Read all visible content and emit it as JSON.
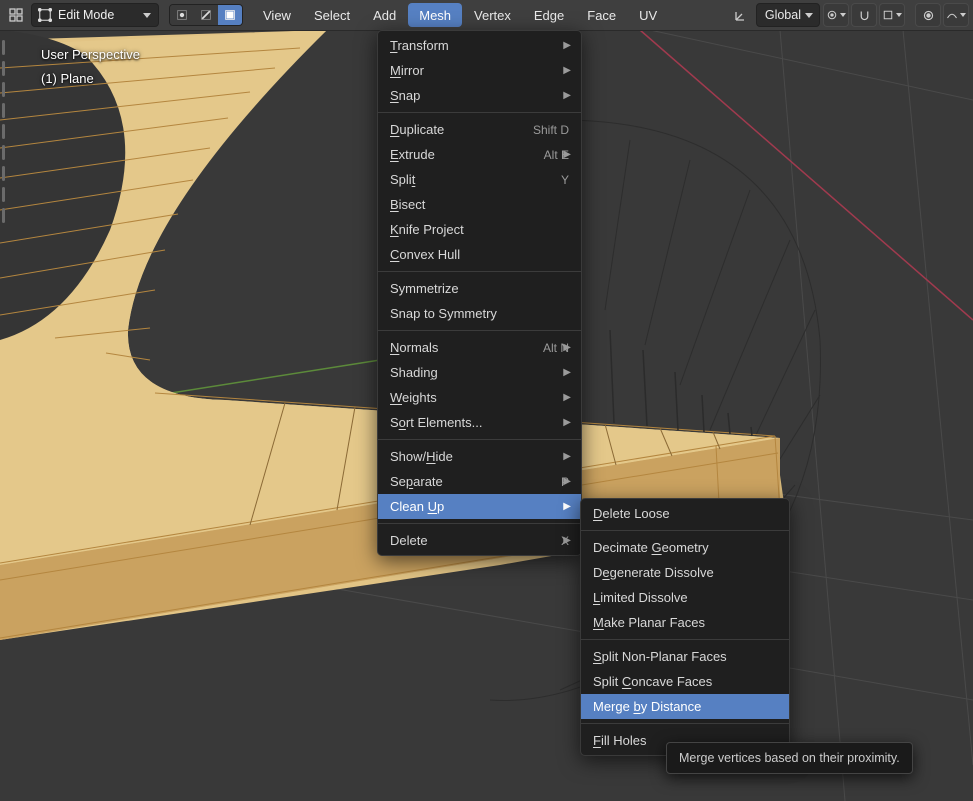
{
  "header": {
    "mode": "Edit Mode",
    "menus": [
      "View",
      "Select",
      "Add",
      "Mesh",
      "Vertex",
      "Edge",
      "Face",
      "UV"
    ],
    "active_menu": "Mesh",
    "orientation": "Global"
  },
  "overlay": {
    "perspective": "User Perspective",
    "object": "(1) Plane"
  },
  "mesh_menu": {
    "groups": [
      [
        {
          "pre": "",
          "u": "T",
          "post": "ransform",
          "sub": true
        },
        {
          "pre": "",
          "u": "M",
          "post": "irror",
          "sub": true
        },
        {
          "pre": "",
          "u": "S",
          "post": "nap",
          "sub": true
        }
      ],
      [
        {
          "pre": "",
          "u": "D",
          "post": "uplicate",
          "sc": "Shift D"
        },
        {
          "pre": "",
          "u": "E",
          "post": "xtrude",
          "sc": "Alt E",
          "sub": true
        },
        {
          "pre": "Spli",
          "u": "t",
          "post": "",
          "sc": "Y"
        },
        {
          "pre": "",
          "u": "B",
          "post": "isect"
        },
        {
          "pre": "",
          "u": "K",
          "post": "nife Project"
        },
        {
          "pre": "",
          "u": "C",
          "post": "onvex Hull"
        }
      ],
      [
        {
          "pre": "Symmetrize",
          "u": "",
          "post": ""
        },
        {
          "pre": "Snap to Symmetry",
          "u": "",
          "post": ""
        }
      ],
      [
        {
          "pre": "",
          "u": "N",
          "post": "ormals",
          "sc": "Alt N",
          "sub": true
        },
        {
          "pre": "Shadin",
          "u": "g",
          "post": "",
          "sub": true
        },
        {
          "pre": "",
          "u": "W",
          "post": "eights",
          "sub": true
        },
        {
          "pre": "S",
          "u": "o",
          "post": "rt Elements...",
          "sub": true
        }
      ],
      [
        {
          "pre": "Show/",
          "u": "H",
          "post": "ide",
          "sub": true
        },
        {
          "pre": "Se",
          "u": "p",
          "post": "arate",
          "sc": "P",
          "sub": true
        },
        {
          "pre": "Clean ",
          "u": "U",
          "post": "p",
          "sub": true,
          "hl": true
        }
      ],
      [
        {
          "pre": "Delete",
          "u": "",
          "post": "",
          "sc": "X",
          "sub": true
        }
      ]
    ]
  },
  "cleanup_menu": {
    "groups": [
      [
        {
          "pre": "",
          "u": "D",
          "post": "elete Loose"
        }
      ],
      [
        {
          "pre": "Decimate ",
          "u": "G",
          "post": "eometry"
        },
        {
          "pre": "D",
          "u": "e",
          "post": "generate Dissolve"
        },
        {
          "pre": "",
          "u": "L",
          "post": "imited Dissolve"
        },
        {
          "pre": "",
          "u": "M",
          "post": "ake Planar Faces"
        }
      ],
      [
        {
          "pre": "",
          "u": "S",
          "post": "plit Non-Planar Faces"
        },
        {
          "pre": "Split ",
          "u": "C",
          "post": "oncave Faces"
        },
        {
          "pre": "Merge ",
          "u": "b",
          "post": "y Distance",
          "hl": true
        }
      ],
      [
        {
          "pre": "",
          "u": "F",
          "post": "ill Holes"
        }
      ]
    ]
  },
  "tooltip": "Merge vertices based on their proximity."
}
